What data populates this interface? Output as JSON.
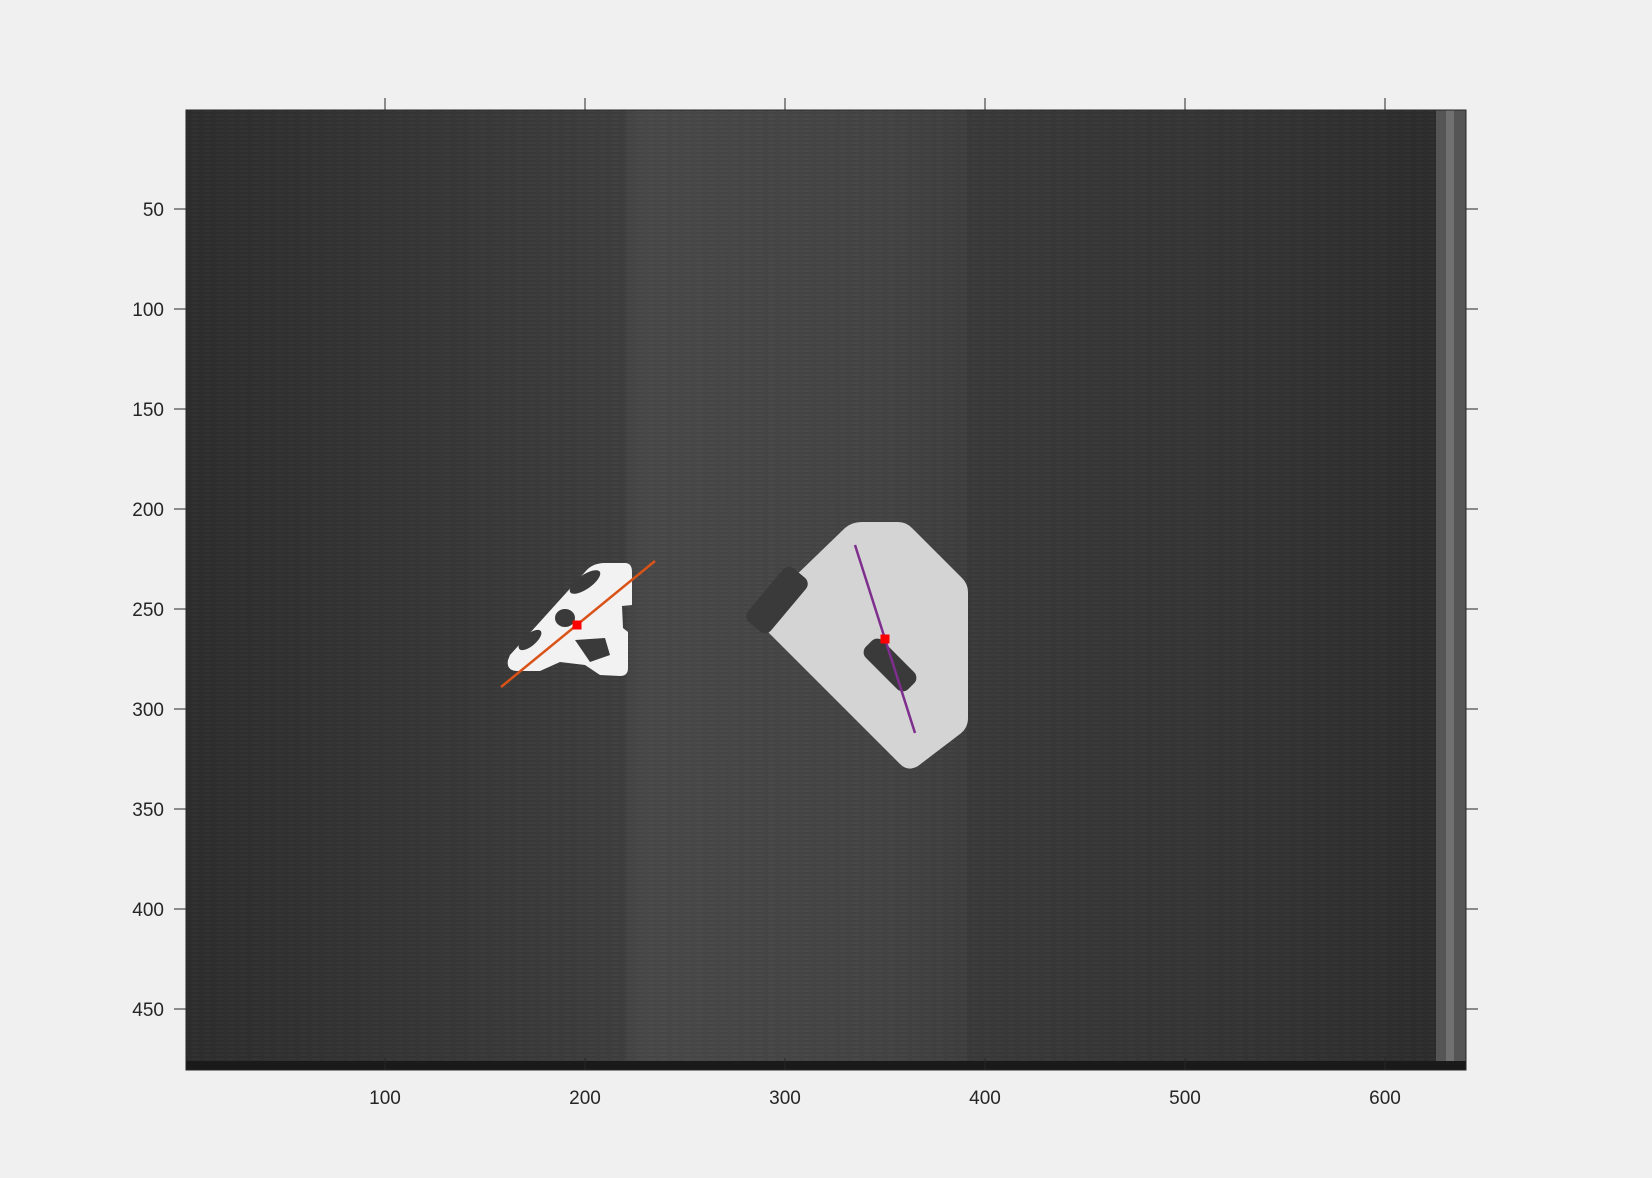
{
  "chart_data": {
    "type": "image",
    "title": "",
    "xlabel": "",
    "ylabel": "",
    "xlim": [
      0.5,
      640.5
    ],
    "ylim": [
      0.5,
      480.5
    ],
    "y_direction": "reverse",
    "x_ticks": [
      100,
      200,
      300,
      400,
      500,
      600
    ],
    "y_ticks": [
      50,
      100,
      150,
      200,
      250,
      300,
      350,
      400,
      450
    ],
    "x_tick_labels": [
      "100",
      "200",
      "300",
      "400",
      "500",
      "600"
    ],
    "y_tick_labels": [
      "50",
      "100",
      "150",
      "200",
      "250",
      "300",
      "350",
      "400",
      "450"
    ],
    "grid": false,
    "image_description": "grayscale conveyor belt with two white parts",
    "lines": [
      {
        "color": "#d95319",
        "x": [
          158,
          235
        ],
        "y": [
          289,
          226
        ]
      },
      {
        "color": "#7e2f8e",
        "x": [
          335,
          365
        ],
        "y": [
          218,
          312
        ]
      }
    ],
    "centroids": [
      {
        "color": "#ff0000",
        "x": [
          196
        ],
        "y": [
          258
        ]
      },
      {
        "color": "#ff0000",
        "x": [
          350
        ],
        "y": [
          265
        ]
      }
    ]
  }
}
